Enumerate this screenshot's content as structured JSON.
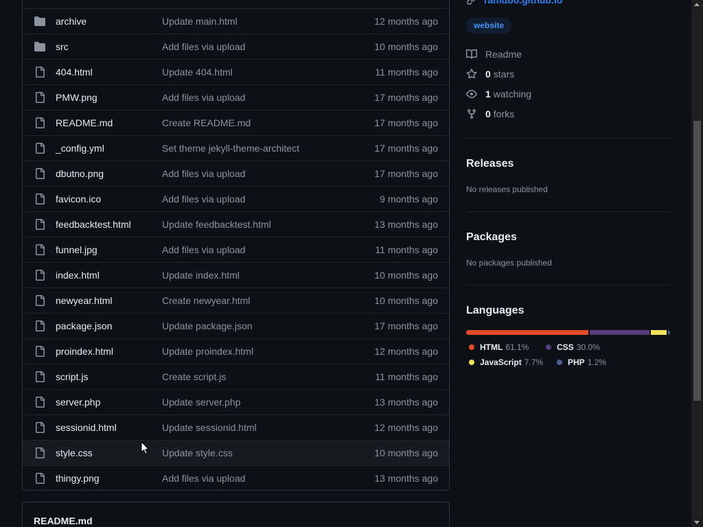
{
  "files": [
    {
      "type": "folder",
      "name": "archive",
      "message": "Update main.html",
      "age": "12 months ago"
    },
    {
      "type": "folder",
      "name": "src",
      "message": "Add files via upload",
      "age": "10 months ago"
    },
    {
      "type": "file",
      "name": "404.html",
      "message": "Update 404.html",
      "age": "11 months ago"
    },
    {
      "type": "file",
      "name": "PMW.png",
      "message": "Add files via upload",
      "age": "17 months ago"
    },
    {
      "type": "file",
      "name": "README.md",
      "message": "Create README.md",
      "age": "17 months ago"
    },
    {
      "type": "file",
      "name": "_config.yml",
      "message": "Set theme jekyll-theme-architect",
      "age": "17 months ago"
    },
    {
      "type": "file",
      "name": "dbutno.png",
      "message": "Add files via upload",
      "age": "17 months ago"
    },
    {
      "type": "file",
      "name": "favicon.ico",
      "message": "Add files via upload",
      "age": "9 months ago"
    },
    {
      "type": "file",
      "name": "feedbacktest.html",
      "message": "Update feedbacktest.html",
      "age": "13 months ago"
    },
    {
      "type": "file",
      "name": "funnel.jpg",
      "message": "Add files via upload",
      "age": "11 months ago"
    },
    {
      "type": "file",
      "name": "index.html",
      "message": "Update index.html",
      "age": "10 months ago"
    },
    {
      "type": "file",
      "name": "newyear.html",
      "message": "Create newyear.html",
      "age": "10 months ago"
    },
    {
      "type": "file",
      "name": "package.json",
      "message": "Update package.json",
      "age": "17 months ago"
    },
    {
      "type": "file",
      "name": "proindex.html",
      "message": "Update proindex.html",
      "age": "12 months ago"
    },
    {
      "type": "file",
      "name": "script.js",
      "message": "Create script.js",
      "age": "11 months ago"
    },
    {
      "type": "file",
      "name": "server.php",
      "message": "Update server.php",
      "age": "13 months ago"
    },
    {
      "type": "file",
      "name": "sessionid.html",
      "message": "Update sessionid.html",
      "age": "12 months ago"
    },
    {
      "type": "file",
      "name": "style.css",
      "message": "Update style.css",
      "age": "10 months ago",
      "hover": true
    },
    {
      "type": "file",
      "name": "thingy.png",
      "message": "Add files via upload",
      "age": "13 months ago"
    }
  ],
  "readme": {
    "title": "README.md"
  },
  "about": {
    "link": "ramdbo.github.io",
    "topic": "website",
    "readme_label": "Readme",
    "stars": {
      "num": "0",
      "label": "stars"
    },
    "watching": {
      "num": "1",
      "label": "watching"
    },
    "forks": {
      "num": "0",
      "label": "forks"
    }
  },
  "releases": {
    "heading": "Releases",
    "sub": "No releases published"
  },
  "packages": {
    "heading": "Packages",
    "sub": "No packages published"
  },
  "languages": {
    "heading": "Languages",
    "items": [
      {
        "name": "HTML",
        "pct": "61.1%",
        "value": 61.1,
        "color": "#e34c26"
      },
      {
        "name": "CSS",
        "pct": "30.0%",
        "value": 30.0,
        "color": "#563d7c"
      },
      {
        "name": "JavaScript",
        "pct": "7.7%",
        "value": 7.7,
        "color": "#f1e05a"
      },
      {
        "name": "PHP",
        "pct": "1.2%",
        "value": 1.2,
        "color": "#4F5D95"
      }
    ]
  },
  "colors": {
    "background": "#0d1117",
    "border": "#30363d",
    "text": "#e6edf3",
    "muted": "#8b949e",
    "link": "#2f81f7"
  }
}
